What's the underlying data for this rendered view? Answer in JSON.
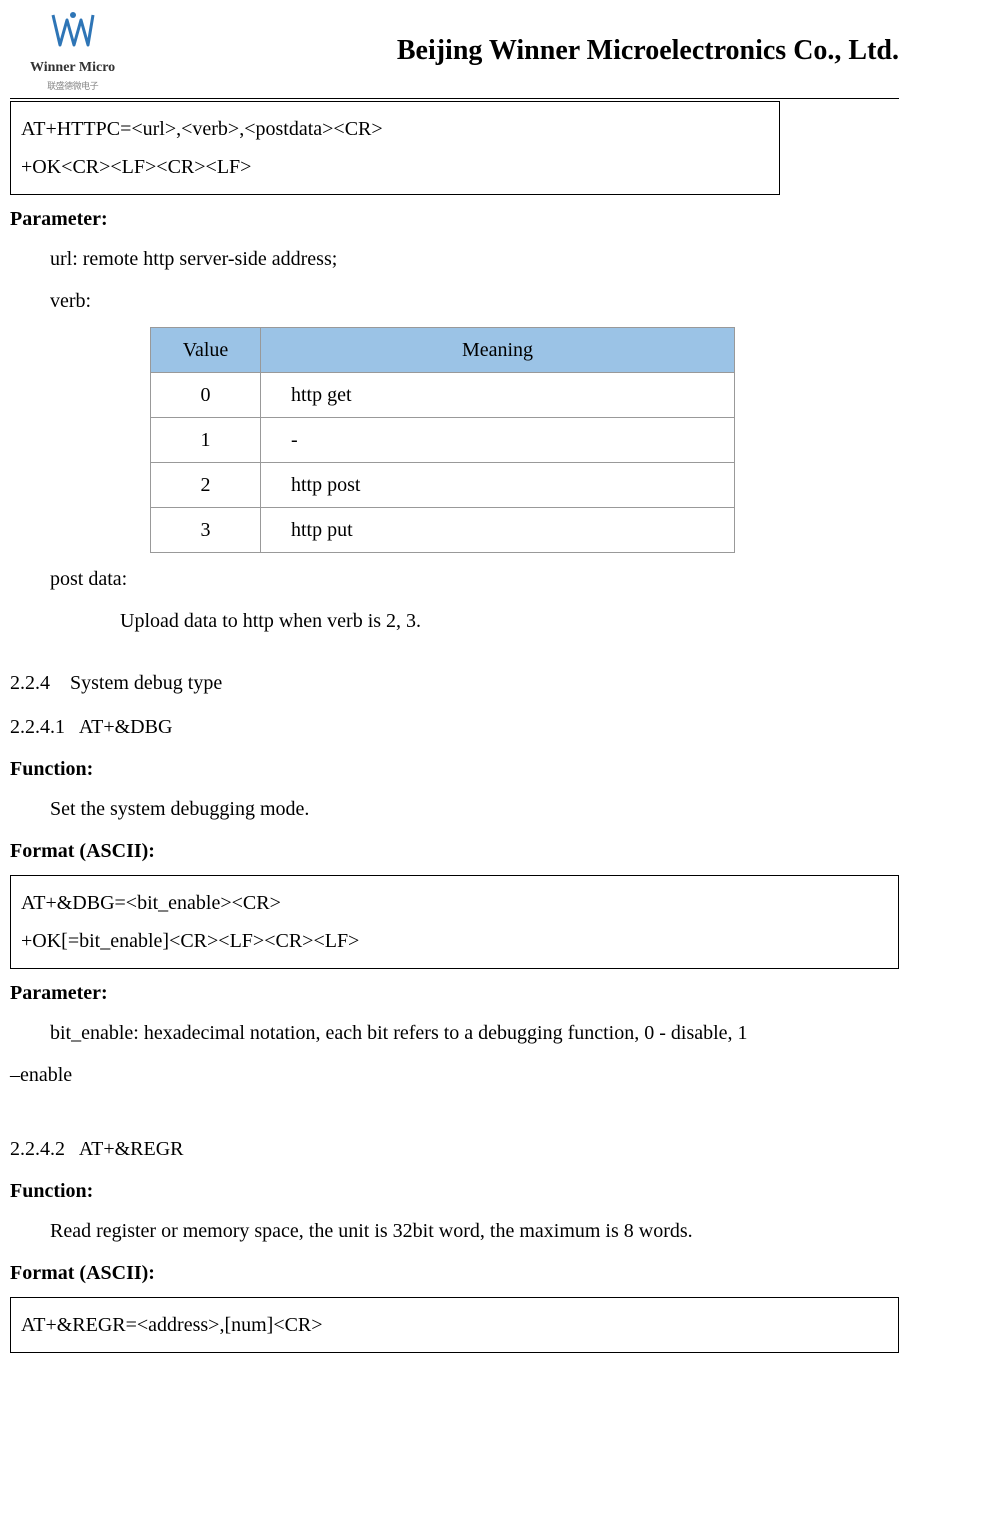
{
  "header": {
    "logo_main": "Winner Micro",
    "logo_sub": "联盛德微电子",
    "company": "Beijing Winner Microelectronics Co., Ltd."
  },
  "box1": {
    "line1": "AT+HTTPC=<url>,<verb>,<postdata><CR>",
    "line2": "+OK<CR><LF><CR><LF>"
  },
  "parameter_label": "Parameter:",
  "param_url": "url: remote http server-side address;",
  "param_verb": "verb:",
  "verb_table": {
    "head_value": "Value",
    "head_meaning": "Meaning",
    "rows": [
      {
        "value": "0",
        "meaning": "http get"
      },
      {
        "value": "1",
        "meaning": "-"
      },
      {
        "value": "2",
        "meaning": "http post"
      },
      {
        "value": "3",
        "meaning": "http put"
      }
    ]
  },
  "param_postdata_label": "post data:",
  "param_postdata_desc": "Upload data to http when verb is 2, 3.",
  "section_224": "2.2.4    System debug type",
  "section_2241": "2.2.4.1   AT+&DBG",
  "function_label": "Function:",
  "function_dbg": "Set the system debugging mode.",
  "format_label": "Format (ASCII):",
  "box2": {
    "line1": "AT+&DBG=<bit_enable><CR>",
    "line2": "+OK[=bit_enable]<CR><LF><CR><LF>"
  },
  "param_bit_enable_a": "bit_enable: hexadecimal notation, each bit refers to a debugging function, 0 - disable, 1",
  "param_bit_enable_b": "–enable",
  "section_2242": "2.2.4.2   AT+&REGR",
  "function_regr": "Read register or memory space, the unit is 32bit word, the maximum is 8 words.",
  "box3": {
    "line1": "AT+&REGR=<address>,[num]<CR>"
  }
}
